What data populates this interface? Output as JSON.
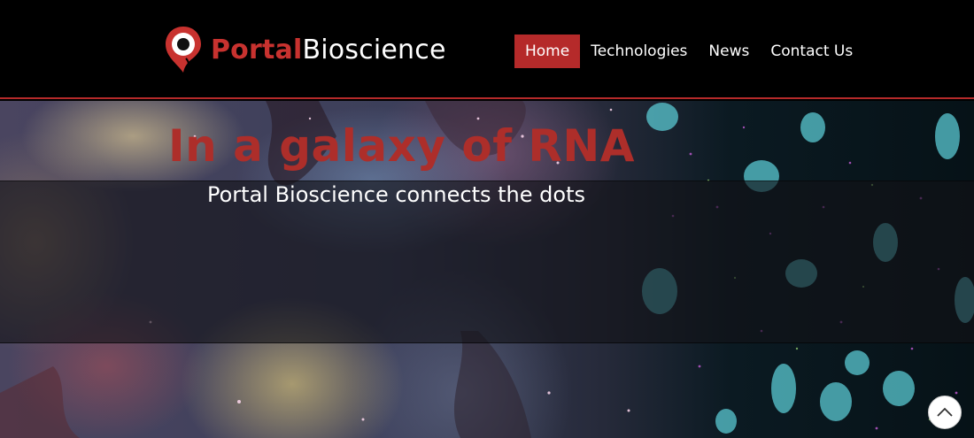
{
  "header": {
    "brand_part1": "Portal",
    "brand_part2": "Bioscience",
    "logo_icon": "map-pin-eye-icon",
    "brand_color": "#c8322f"
  },
  "nav": {
    "items": [
      {
        "label": "Home",
        "active": true
      },
      {
        "label": "Technologies",
        "active": false
      },
      {
        "label": "News",
        "active": false
      },
      {
        "label": "Contact Us",
        "active": false
      }
    ],
    "active_color": "#b52a2a"
  },
  "hero": {
    "headline": "In a galaxy of RNA",
    "subheadline": "Portal Bioscience connects the dots",
    "headline_color": "#ad2e2a",
    "background": "nebula-and-cell-nuclei-image"
  },
  "scroll_top": {
    "icon": "chevron-up-icon"
  }
}
